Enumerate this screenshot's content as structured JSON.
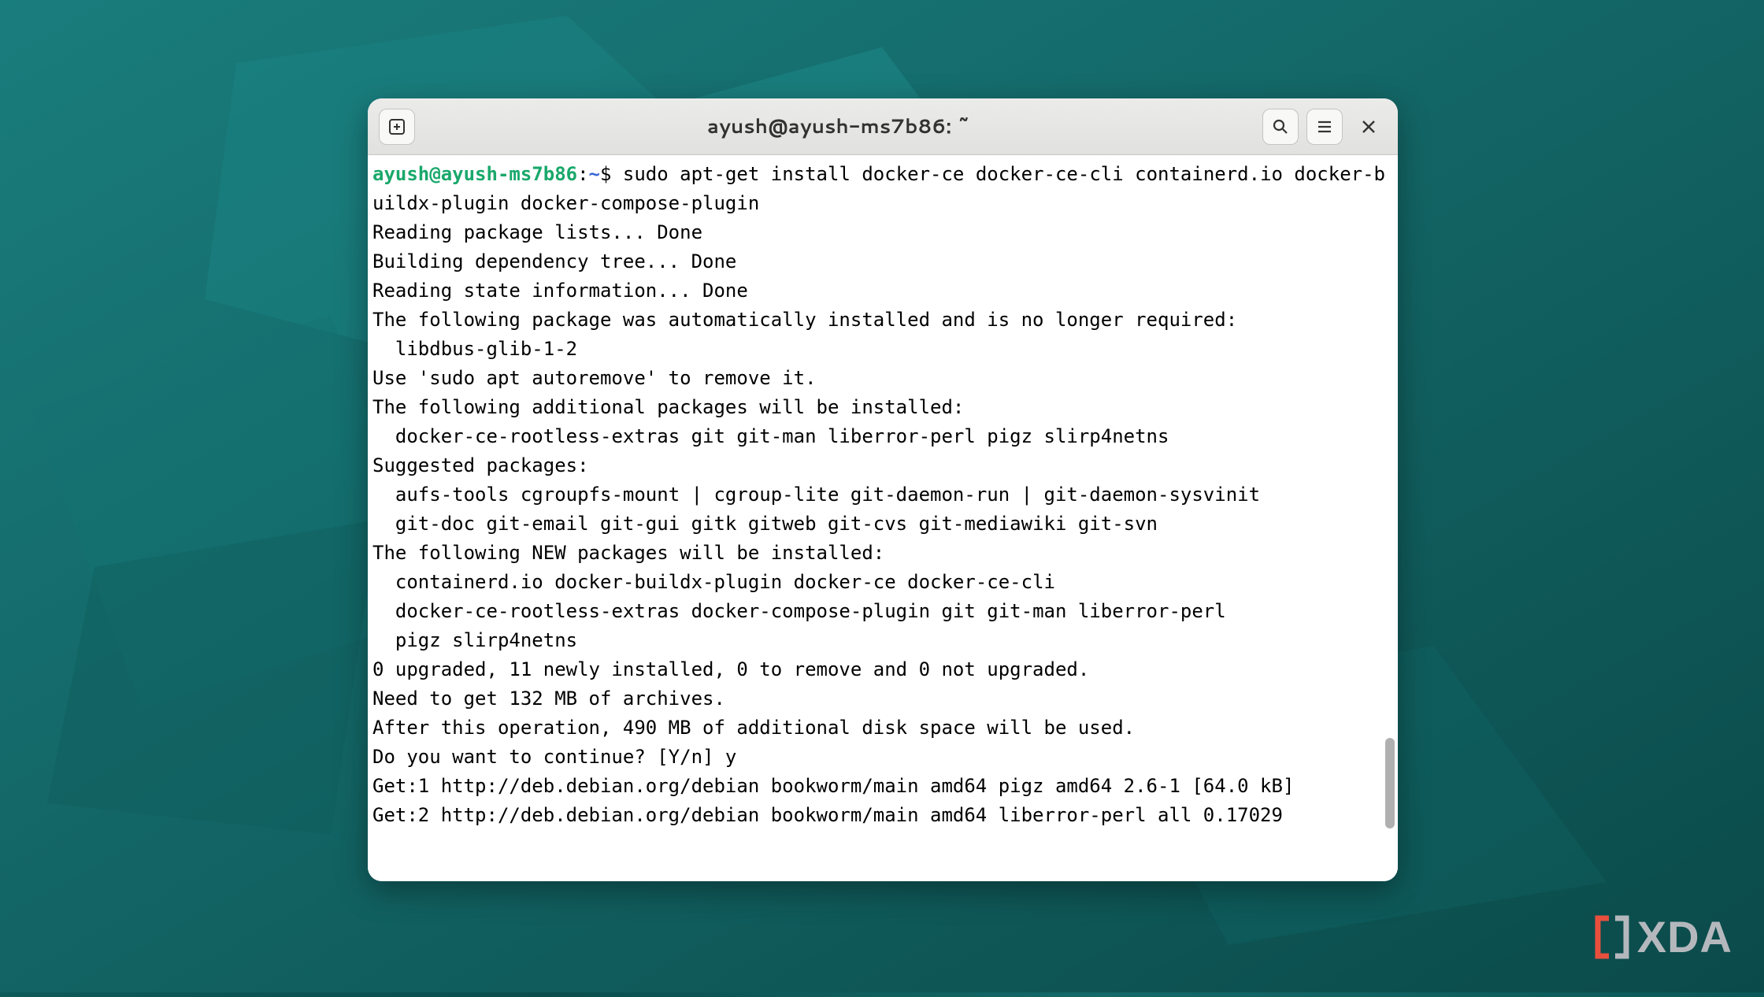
{
  "titlebar": {
    "title": "ayush@ayush-ms7b86: ~"
  },
  "prompt": {
    "user_host": "ayush@ayush-ms7b86",
    "path": "~",
    "symbol": "$",
    "command": "sudo apt-get install docker-ce docker-ce-cli containerd.io docker-buildx-plugin docker-compose-plugin"
  },
  "output": {
    "lines": [
      "Reading package lists... Done",
      "Building dependency tree... Done",
      "Reading state information... Done",
      "The following package was automatically installed and is no longer required:",
      "  libdbus-glib-1-2",
      "Use 'sudo apt autoremove' to remove it.",
      "The following additional packages will be installed:",
      "  docker-ce-rootless-extras git git-man liberror-perl pigz slirp4netns",
      "Suggested packages:",
      "  aufs-tools cgroupfs-mount | cgroup-lite git-daemon-run | git-daemon-sysvinit",
      "  git-doc git-email git-gui gitk gitweb git-cvs git-mediawiki git-svn",
      "The following NEW packages will be installed:",
      "  containerd.io docker-buildx-plugin docker-ce docker-ce-cli",
      "  docker-ce-rootless-extras docker-compose-plugin git git-man liberror-perl",
      "  pigz slirp4netns",
      "0 upgraded, 11 newly installed, 0 to remove and 0 not upgraded.",
      "Need to get 132 MB of archives.",
      "After this operation, 490 MB of additional disk space will be used.",
      "Do you want to continue? [Y/n] y",
      "Get:1 http://deb.debian.org/debian bookworm/main amd64 pigz amd64 2.6-1 [64.0 kB]",
      "Get:2 http://deb.debian.org/debian bookworm/main amd64 liberror-perl all 0.17029"
    ]
  },
  "branding": {
    "text": "XDA"
  }
}
